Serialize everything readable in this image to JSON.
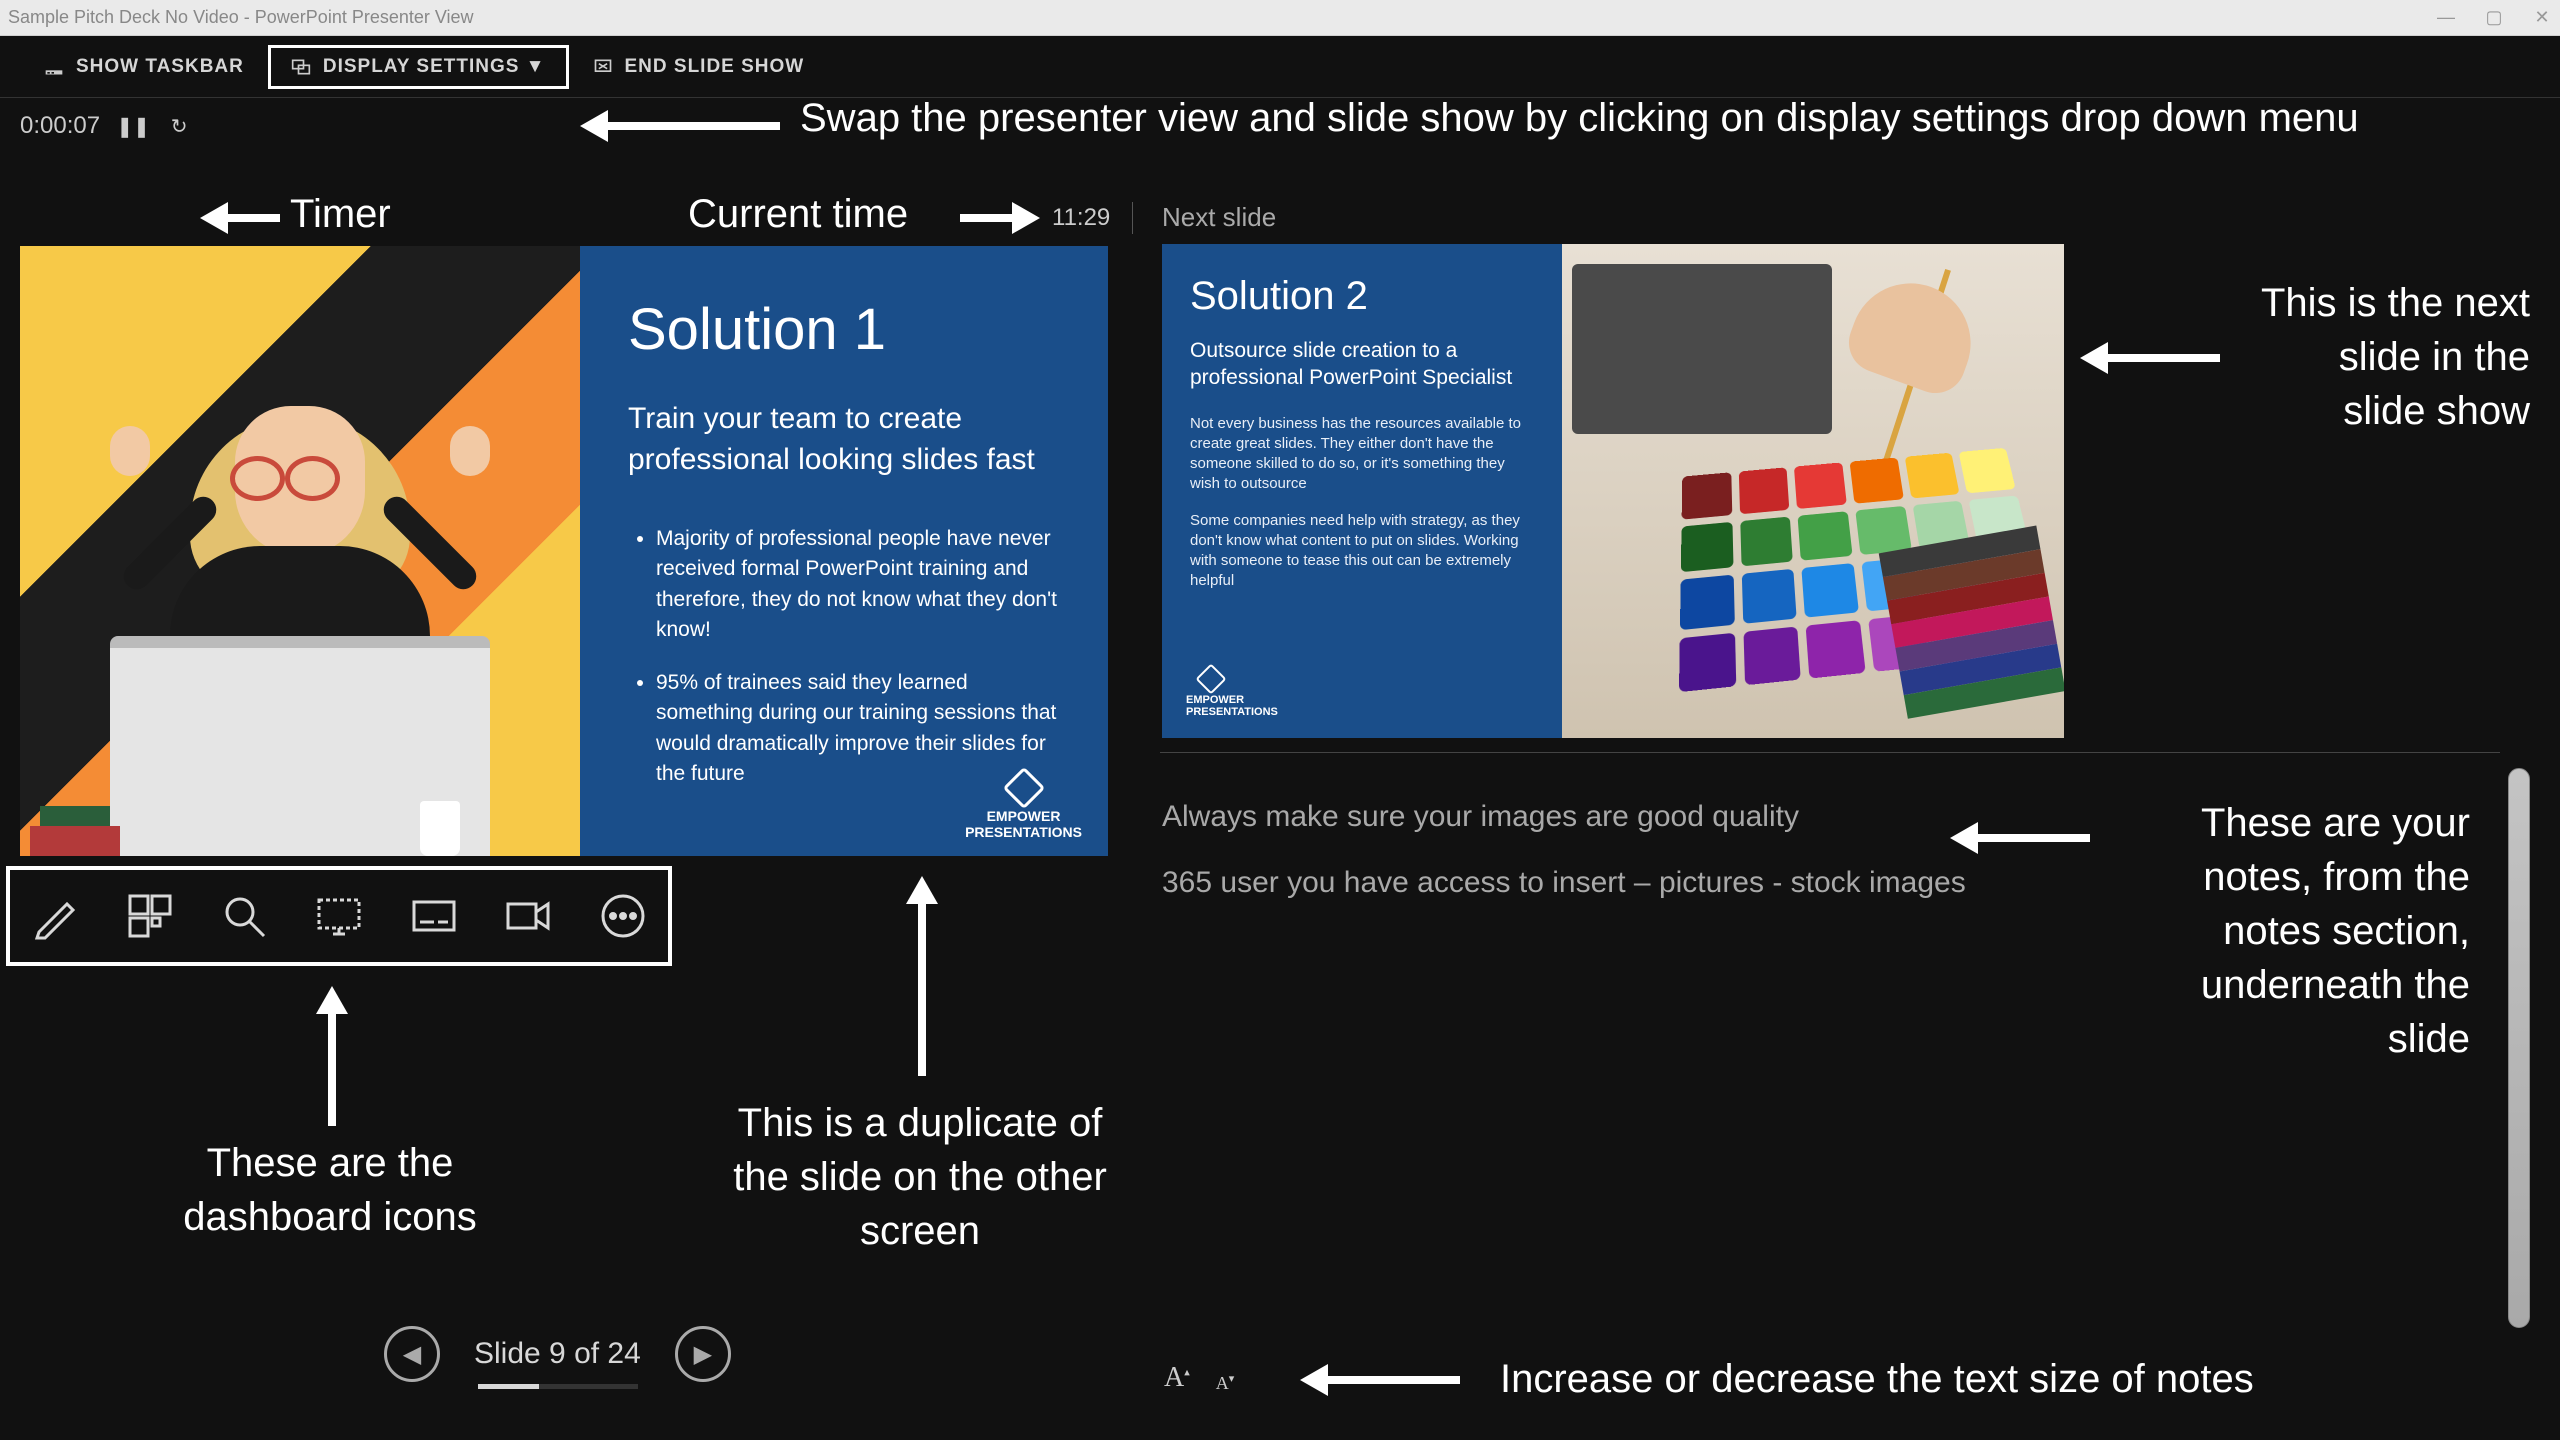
{
  "window": {
    "title": "Sample Pitch Deck No Video - PowerPoint Presenter View"
  },
  "toolbar": {
    "show_taskbar": "SHOW TASKBAR",
    "display_settings": "DISPLAY SETTINGS ▼",
    "end_slide_show": "END SLIDE SHOW"
  },
  "timer": {
    "elapsed": "0:00:07",
    "clock": "11:29"
  },
  "labels": {
    "next_slide": "Next slide",
    "slide_counter": "Slide 9 of 24"
  },
  "current_slide": {
    "title": "Solution 1",
    "subtitle": "Train your team to create professional looking slides fast",
    "bullets": [
      "Majority of professional people have never received formal PowerPoint training and therefore, they do not know what they don't know!",
      "95% of trainees said they learned something during our training sessions that would dramatically improve their slides for the future"
    ],
    "logo": "EMPOWER\nPRESENTATIONS"
  },
  "next_slide": {
    "title": "Solution 2",
    "subtitle": "Outsource slide creation to a professional PowerPoint Specialist",
    "para1": "Not every business has the resources available to create great slides. They either don't have the someone skilled to do so, or it's something they wish to outsource",
    "para2": "Some companies need help with strategy, as they don't know what content to put on slides. Working with someone to tease this out can be extremely helpful",
    "logo": "EMPOWER\nPRESENTATIONS",
    "swatch_colors": [
      "#7a1f1f",
      "#c62828",
      "#e53935",
      "#ef6c00",
      "#fbc02d",
      "#fff176",
      "#1b5e20",
      "#2e7d32",
      "#43a047",
      "#66bb6a",
      "#a5d6a7",
      "#c8e6c9",
      "#0d47a1",
      "#1565c0",
      "#1e88e5",
      "#42a5f5",
      "#90caf9",
      "#bbdefb",
      "#4a148c",
      "#6a1b9a",
      "#8e24aa",
      "#ab47bc",
      "#ce93d8",
      "#e1bee7"
    ],
    "pantone_rows": [
      "#3a3a3a",
      "#6b3a2a",
      "#8a1f1f",
      "#c2185b",
      "#5a3a7a",
      "#283a8a",
      "#2a6a3a"
    ]
  },
  "notes": {
    "line1": "Always make sure your images are good quality",
    "line2": "365 user you have access to insert – pictures - stock images"
  },
  "annotations": {
    "top": "Swap the presenter view and slide show by clicking on display settings drop down menu",
    "timer": "Timer",
    "clock": "Current time",
    "next_thumb": "This is the next slide in the slide show",
    "notes_box": "These are your notes, from the notes section, underneath the slide",
    "dash_icons": "These are the dashboard icons",
    "dup_slide": "This is a duplicate of the slide on the other screen",
    "font_ctrl": "Increase or decrease the text size of notes"
  }
}
